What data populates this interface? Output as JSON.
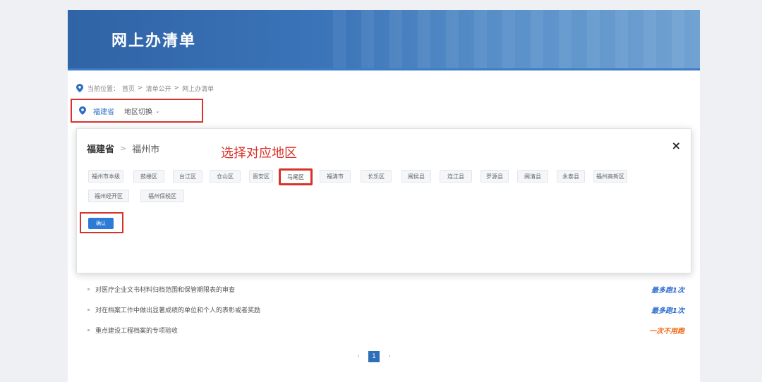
{
  "banner": {
    "title": "网上办清单"
  },
  "breadcrumb": {
    "label": "当前位置：",
    "items": [
      "首页",
      ">",
      "清单公开",
      ">",
      "网上办清单"
    ]
  },
  "region_selector": {
    "province": "福建省",
    "switch_label": "地区切换",
    "caret": "⌄"
  },
  "region_panel": {
    "province": "福建省",
    "separator": ">",
    "city": "福州市",
    "annotation": "选择对应地区",
    "close": "×",
    "districts": [
      {
        "label": "福州市本级"
      },
      {
        "label": "鼓楼区"
      },
      {
        "label": "台江区"
      },
      {
        "label": "仓山区"
      },
      {
        "label": "晋安区"
      },
      {
        "label": "马尾区"
      },
      {
        "label": "福清市"
      },
      {
        "label": "长乐区"
      },
      {
        "label": "闽侯县"
      },
      {
        "label": "连江县"
      },
      {
        "label": "罗源县"
      },
      {
        "label": "闽清县"
      },
      {
        "label": "永泰县"
      },
      {
        "label": "福州高新区"
      },
      {
        "label": "福州经开区"
      },
      {
        "label": "福州保税区"
      }
    ],
    "highlighted_index": 5,
    "confirm_label": "确认"
  },
  "list": {
    "rows": [
      {
        "text": "对医疗企业文书材料归档范围和保管期限表的审查",
        "badge": "最多跑1次"
      },
      {
        "text": "对在档案工作中做出显著成绩的单位和个人的表彰或者奖励",
        "badge": "最多跑1次"
      },
      {
        "text": "重点建设工程档案的专项验收",
        "badge": "一次不用跑"
      }
    ]
  },
  "pagination": {
    "prev": "‹",
    "current": "1",
    "next": "›"
  },
  "colors": {
    "accent": "#2d6fb8",
    "annotation_red": "#d8322a",
    "badge_blue": "#2f6fd1",
    "badge_orange": "#ef6a16"
  }
}
